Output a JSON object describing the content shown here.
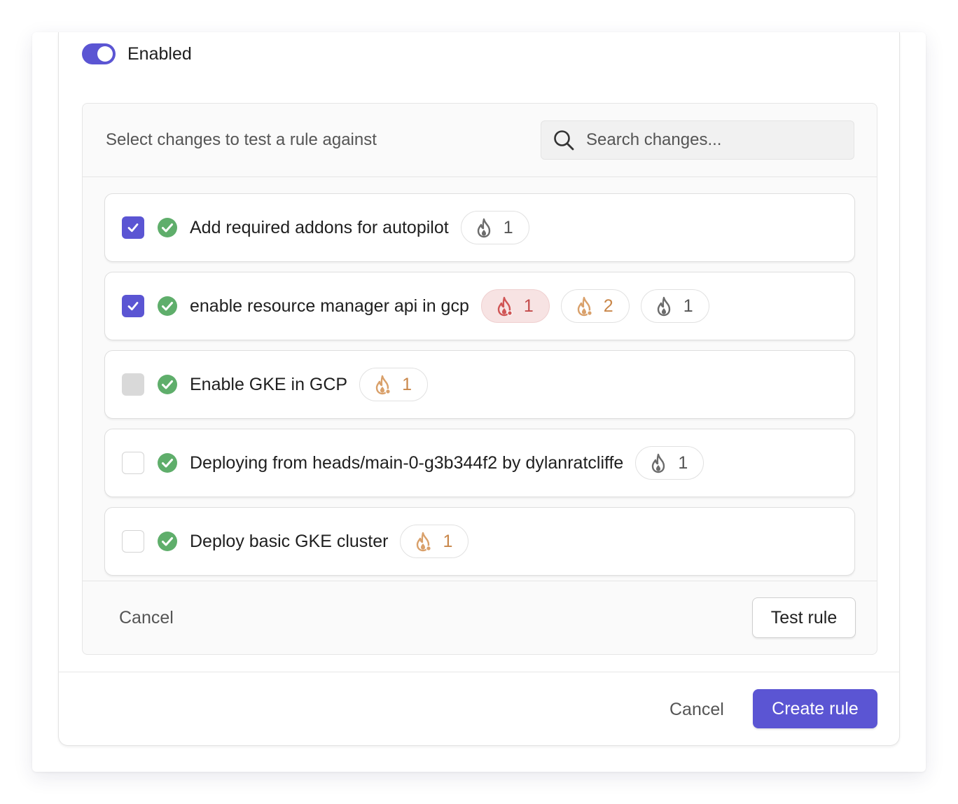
{
  "toggle": {
    "label": "Enabled",
    "on": true
  },
  "panel": {
    "title": "Select changes to test a rule against",
    "search": {
      "placeholder": "Search changes...",
      "value": ""
    },
    "changes": [
      {
        "label": "Add required addons for autopilot",
        "checked": "checked",
        "badges": [
          {
            "severity": "gray",
            "count": "1"
          }
        ]
      },
      {
        "label": "enable resource manager api in gcp",
        "checked": "checked",
        "badges": [
          {
            "severity": "red",
            "count": "1"
          },
          {
            "severity": "orange",
            "count": "2"
          },
          {
            "severity": "gray",
            "count": "1"
          }
        ]
      },
      {
        "label": "Enable GKE in GCP",
        "checked": "indeterminate",
        "badges": [
          {
            "severity": "orange",
            "count": "1"
          }
        ]
      },
      {
        "label": "Deploying from heads/main-0-g3b344f2 by dylanratcliffe",
        "checked": "empty",
        "badges": [
          {
            "severity": "gray",
            "count": "1"
          }
        ]
      },
      {
        "label": "Deploy basic GKE cluster",
        "checked": "empty",
        "badges": [
          {
            "severity": "orange",
            "count": "1"
          }
        ]
      }
    ],
    "cancel_label": "Cancel",
    "test_label": "Test rule"
  },
  "footer": {
    "cancel_label": "Cancel",
    "create_label": "Create rule"
  },
  "colors": {
    "accent": "#5b55d3",
    "success": "#5fae6b",
    "risk_high": "#d05555",
    "risk_medium": "#d9a06a",
    "risk_low": "#6b6b6b"
  }
}
